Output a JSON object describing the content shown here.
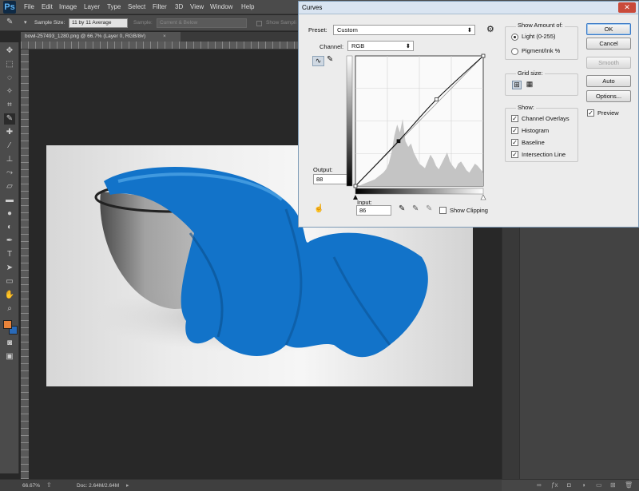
{
  "app": {
    "logo": "Ps"
  },
  "menu": [
    "File",
    "Edit",
    "Image",
    "Layer",
    "Type",
    "Select",
    "Filter",
    "3D",
    "View",
    "Window",
    "Help"
  ],
  "options": {
    "sample_size_label": "Sample Size:",
    "sample_size_value": "11 by 11 Average",
    "sample_label": "Sample:",
    "sample_value": "Current & Below",
    "show_sampling": "Show Sampli"
  },
  "document": {
    "tab_title": "bowl-257493_1280.png @ 66.7% (Layer 0, RGB/8#)"
  },
  "status": {
    "zoom": "66.67%",
    "doc": "Doc: 2.64M/2.64M"
  },
  "colors": {
    "foreground": "#e8833a",
    "background": "#2a6ab8",
    "cloth": "#1273c9"
  },
  "curves": {
    "title": "Curves",
    "preset_label": "Preset:",
    "preset_value": "Custom",
    "channel_label": "Channel:",
    "channel_value": "RGB",
    "output_label": "Output:",
    "output_value": "88",
    "input_label": "Input:",
    "input_value": "86",
    "show_clipping": "Show Clipping",
    "buttons": {
      "ok": "OK",
      "cancel": "Cancel",
      "smooth": "Smooth",
      "auto": "Auto",
      "options": "Options..."
    },
    "preview": "Preview",
    "show_amount_title": "Show Amount of:",
    "light": "Light (0-255)",
    "pigment": "Pigment/Ink %",
    "grid_size_title": "Grid size:",
    "show_title": "Show:",
    "show_items": [
      "Channel Overlays",
      "Histogram",
      "Baseline",
      "Intersection Line"
    ]
  },
  "chart_data": {
    "type": "line",
    "title": "",
    "xlabel": "Input",
    "ylabel": "Output",
    "xlim": [
      0,
      255
    ],
    "ylim": [
      0,
      255
    ],
    "series": [
      {
        "x": [
          0,
          86,
          162,
          255
        ],
        "y": [
          0,
          88,
          170,
          255
        ]
      }
    ]
  }
}
